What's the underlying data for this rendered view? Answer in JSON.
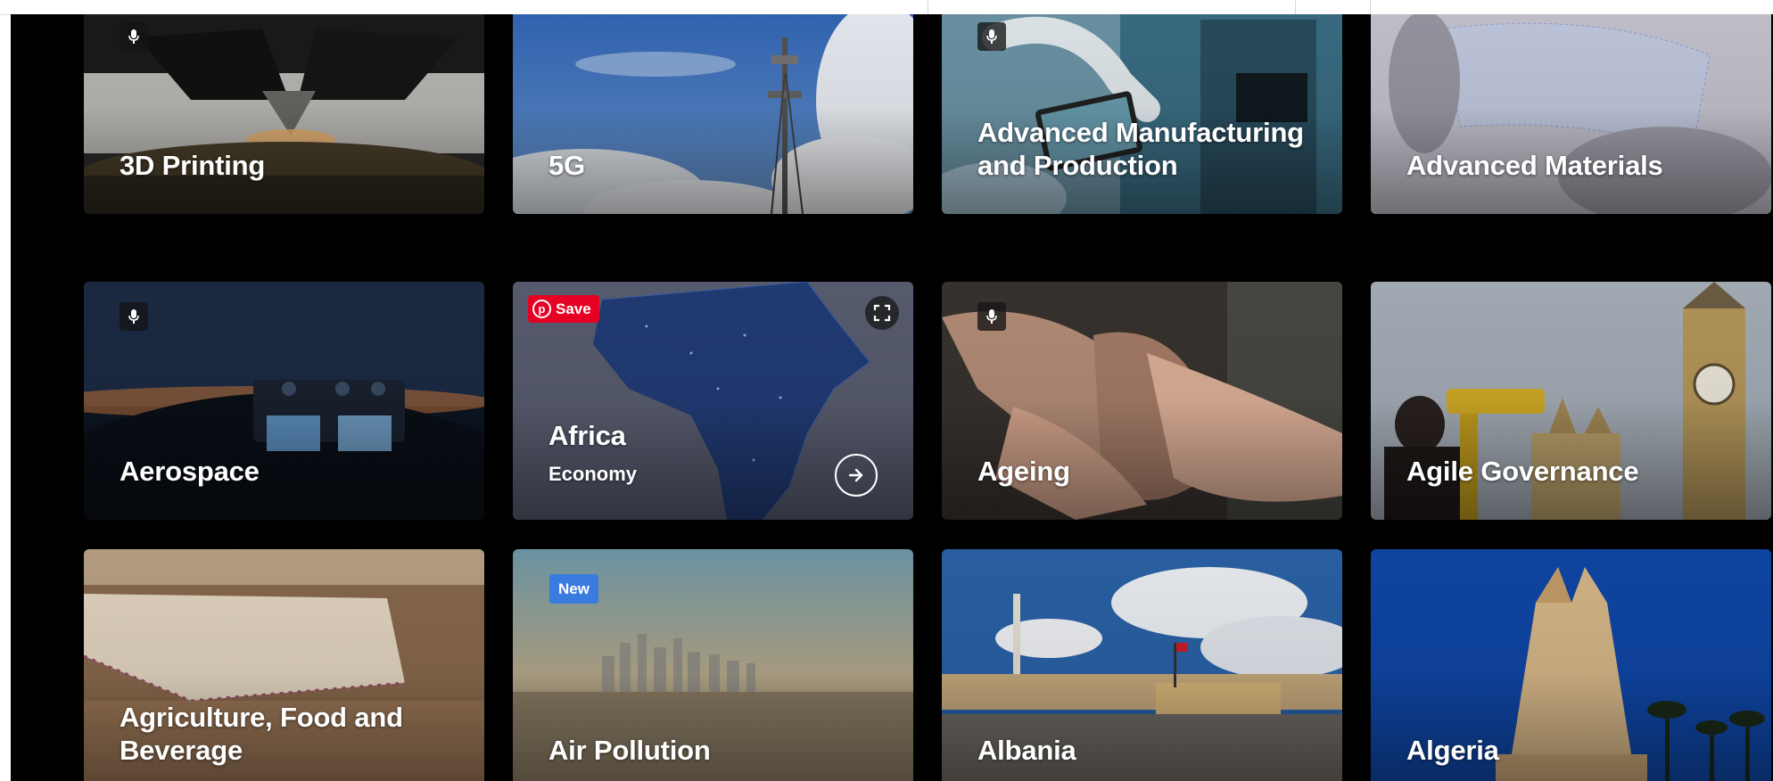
{
  "badges": {
    "save": "Save",
    "new": "New"
  },
  "tiles": [
    {
      "title": "3D Printing",
      "subtitle": "",
      "mic": true
    },
    {
      "title": "5G",
      "subtitle": "",
      "mic": false
    },
    {
      "title": "Advanced Manufacturing and Production",
      "subtitle": "",
      "mic": true
    },
    {
      "title": "Advanced Materials",
      "subtitle": "",
      "mic": false
    },
    {
      "title": "Aerospace",
      "subtitle": "",
      "mic": true
    },
    {
      "title": "Africa",
      "subtitle": "Economy",
      "mic": false
    },
    {
      "title": "Ageing",
      "subtitle": "",
      "mic": true
    },
    {
      "title": "Agile Governance",
      "subtitle": "",
      "mic": false
    },
    {
      "title": "Agriculture, Food and Beverage",
      "subtitle": "",
      "mic": false
    },
    {
      "title": "Air Pollution",
      "subtitle": "",
      "mic": false
    },
    {
      "title": "Albania",
      "subtitle": "",
      "mic": false
    },
    {
      "title": "Algeria",
      "subtitle": "",
      "mic": false
    }
  ],
  "colors": {
    "background": "#000000",
    "pinterest_red": "#e60023",
    "new_badge_blue": "#3a7be0"
  },
  "icons": {
    "mic": "microphone-icon",
    "expand": "expand-icon",
    "arrow": "arrow-right-circle-icon",
    "pinterest": "pinterest-icon"
  }
}
